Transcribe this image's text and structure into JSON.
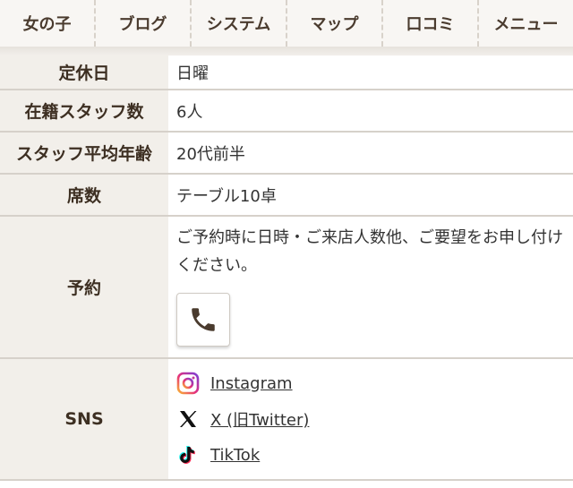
{
  "nav": {
    "items": [
      {
        "label": "女の子"
      },
      {
        "label": "ブログ"
      },
      {
        "label": "システム"
      },
      {
        "label": "マップ"
      },
      {
        "label": "口コミ"
      },
      {
        "label": "メニュー"
      }
    ]
  },
  "info": {
    "holiday": {
      "label": "定休日",
      "value": "日曜"
    },
    "staff_count": {
      "label": "在籍スタッフ数",
      "value": "6人"
    },
    "staff_age": {
      "label": "スタッフ平均年齢",
      "value": "20代前半"
    },
    "seats": {
      "label": "席数",
      "value": "テーブル10卓"
    },
    "reservation": {
      "label": "予約",
      "text": "ご予約時に日時・ご来店人数他、ご要望をお申し付けください。",
      "phone_icon": "phone-icon"
    },
    "sns": {
      "label": "SNS",
      "links": [
        {
          "label": "Instagram",
          "icon": "instagram-icon"
        },
        {
          "label": "X (旧Twitter)",
          "icon": "x-icon"
        },
        {
          "label": "TikTok",
          "icon": "tiktok-icon"
        }
      ]
    }
  },
  "colors": {
    "header_bg": "#f2efea",
    "label_text": "#3d2f22",
    "phone_icon": "#4a3b2e"
  }
}
